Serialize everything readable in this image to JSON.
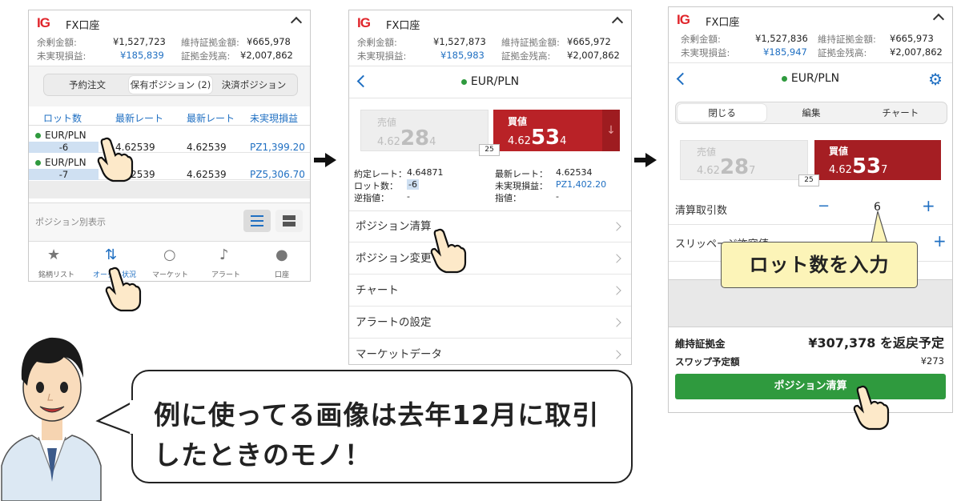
{
  "common": {
    "logo": "IG",
    "account": "FX口座",
    "labels": {
      "margin_avail": "余剰金額:",
      "maint": "維持証拠金額:",
      "unreal": "未実現損益:",
      "balance": "証拠金残高:"
    }
  },
  "panel1": {
    "margin_avail": "¥1,527,723",
    "maint": "¥665,978",
    "unreal": "¥185,839",
    "balance": "¥2,007,862",
    "tabs": [
      "予約注文",
      "保有ポジション (2)",
      "決済ポジション"
    ],
    "columns": [
      "ロット数",
      "最新レート",
      "最新レート",
      "未実現損益"
    ],
    "rows": [
      {
        "pair": "EUR/PLN",
        "lots": "-6",
        "rate1": "4.62539",
        "rate2": "4.62539",
        "pl": "PZ1,399.20"
      },
      {
        "pair": "EUR/PLN",
        "lots": "-7",
        "rate1": "4.62539",
        "rate2": "4.62539",
        "pl": "PZ5,306.70"
      }
    ],
    "view_label": "ポジション別表示",
    "nav": [
      {
        "label": "銘柄リスト",
        "icon": "★"
      },
      {
        "label": "オーダー状況",
        "icon": "⇅"
      },
      {
        "label": "マーケット",
        "icon": "○"
      },
      {
        "label": "アラート",
        "icon": "♪"
      },
      {
        "label": "口座",
        "icon": "●"
      }
    ]
  },
  "panel2": {
    "margin_avail": "¥1,527,873",
    "maint": "¥665,972",
    "unreal": "¥185,983",
    "balance": "¥2,007,862",
    "pair": "EUR/PLN",
    "sell_label": "売値",
    "sell_pre": "4.62",
    "sell_big": "28",
    "sell_post": "4",
    "buy_label": "買値",
    "buy_pre": "4.62",
    "buy_big": "53",
    "buy_post": "4",
    "spread": "25",
    "details": {
      "entry_label": "約定レート：",
      "entry": "4.64871",
      "latest_label": "最新レート：",
      "latest": "4.62534",
      "lots_label": "ロット数：",
      "lots": "-6",
      "unreal_label": "未実現損益：",
      "unreal_pl": "PZ1,402.20",
      "stop_label": "逆指値：",
      "stop": "-",
      "limit_label": "指値：",
      "limit": "-"
    },
    "menu": [
      "ポジション清算",
      "ポジション変更",
      "チャート",
      "アラートの設定",
      "マーケットデータ"
    ]
  },
  "panel3": {
    "margin_avail": "¥1,527,836",
    "maint": "¥665,973",
    "unreal": "¥185,947",
    "balance": "¥2,007,862",
    "pair": "EUR/PLN",
    "tabs": [
      "閉じる",
      "編集",
      "チャート"
    ],
    "sell_label": "売値",
    "sell_pre": "4.62",
    "sell_big": "28",
    "sell_post": "7",
    "buy_label": "買値",
    "buy_pre": "4.62",
    "buy_big": "53",
    "buy_post": "7",
    "spread": "25",
    "qty_label": "清算取引数",
    "qty": "6",
    "slip_label": "スリッページ許容値",
    "tooltip": "ロット数を入力",
    "maint_label": "維持証拠金",
    "maint_return": "¥307,378 を返戻予定",
    "swap_label": "スワップ予定額",
    "swap": "¥273",
    "close_button": "ポジション清算"
  },
  "speech": {
    "line1": "例に使ってる画像は去年12月に取引",
    "line2": "したときのモノ！"
  }
}
